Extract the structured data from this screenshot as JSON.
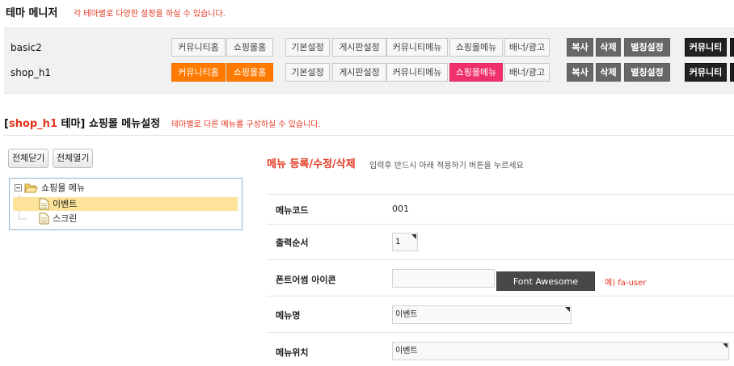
{
  "header": {
    "title": "테마 메니저",
    "description": "각 테마별로 다양한 설정을 하실 수 있습니다."
  },
  "themes": [
    {
      "name": "basic2",
      "home_buttons": [
        "커뮤니티홈",
        "쇼핑몰홈"
      ],
      "setting_buttons": [
        "기본설정",
        "게시판설정",
        "커뮤니티메뉴",
        "쇼핑몰메뉴",
        "배너/광고"
      ],
      "action_buttons": [
        "복사",
        "삭제",
        "별칭설정"
      ],
      "apply_buttons": [
        "커뮤니티"
      ]
    },
    {
      "name": "shop_h1",
      "home_buttons": [
        "커뮤니티홈",
        "쇼핑몰홈"
      ],
      "setting_buttons": [
        "기본설정",
        "게시판설정",
        "커뮤니티메뉴",
        "쇼핑몰메뉴",
        "배너/광고"
      ],
      "action_buttons": [
        "복사",
        "삭제",
        "별칭설정"
      ],
      "apply_buttons": [
        "커뮤니티"
      ]
    }
  ],
  "section": {
    "bracket_open": "[",
    "theme_name": "shop_h1",
    "theme_suffix": " 테마]",
    "title": " 쇼핑몰 메뉴설정",
    "description": "테마별로 다른 메뉴를 구성하실 수 있습니다."
  },
  "tree_controls": {
    "collapse_all": "전체닫기",
    "expand_all": "전체열기"
  },
  "tree": {
    "root": "쇼핑몰 메뉴",
    "children": [
      "이벤트",
      "스크린"
    ],
    "selected": "이벤트"
  },
  "form": {
    "title": "메뉴 등록/수정/삭제",
    "description": "입력후 반드시 아래 적용하기 버튼을 누르세요",
    "menu_code_label": "메뉴코드",
    "menu_code_value": "001",
    "order_label": "출력순서",
    "order_value": "1",
    "icon_label": "폰트어썸 아이콘",
    "icon_value": "",
    "icon_button": "Font Awesome",
    "icon_hint": "예) fa-user",
    "name_label": "메뉴명",
    "name_value": "이벤트",
    "location_label": "메뉴위치",
    "location_value": "이벤트"
  },
  "colors": {
    "accent_red": "#e4361f",
    "active_orange": "#ff7a00",
    "active_pink": "#f0306a",
    "selected_row": "#fde49a"
  }
}
